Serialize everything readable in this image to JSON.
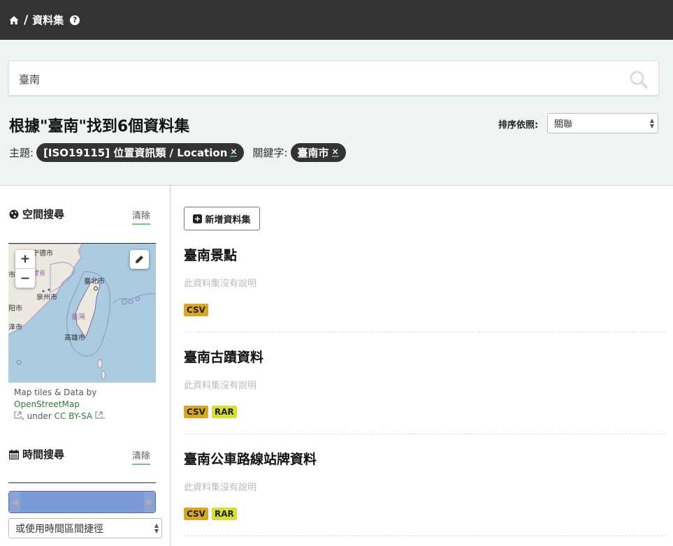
{
  "header": {
    "separator": "/",
    "breadcrumb": "資料集",
    "help_glyph": "?"
  },
  "search": {
    "query": "臺南"
  },
  "results": {
    "heading": "根據\"臺南\"找到6個資料集",
    "sort_label": "排序依照:",
    "sort_value": "關聯"
  },
  "facets": {
    "theme_label": "主題:",
    "theme_value": "[ISO19115] 位置資訊類 / Location",
    "keyword_label": "關鍵字:",
    "keyword_value": "臺南市",
    "remove_glyph": "×"
  },
  "sidebar": {
    "spatial_title": "空間搜尋",
    "clear_label": "清除",
    "map_labels": {
      "ningde": "宁德市",
      "fujian": "福建省",
      "taipei": "臺北市",
      "quanzhou": "泉州市",
      "taiwan": "臺灣",
      "kaohsiung": "高雄市",
      "frag1": "市",
      "frag2": "市",
      "frag3": "阳市",
      "frag4": "泽市"
    },
    "attribution_prefix": "Map tiles & Data by",
    "attribution_osm": "OpenStreetMap",
    "attribution_under": ", under",
    "attribution_license": "CC BY-SA",
    "attribution_end": ".",
    "time_title": "時間搜尋",
    "time_clear_label": "清除",
    "time_select": "或使用時間區間捷徑",
    "zoom_in": "+",
    "zoom_out": "−"
  },
  "actions": {
    "add_dataset": "新增資料集"
  },
  "datasets": [
    {
      "title": "臺南景點",
      "description": "此資料集沒有說明",
      "formats": [
        "CSV"
      ]
    },
    {
      "title": "臺南古蹟資料",
      "description": "此資料集沒有說明",
      "formats": [
        "CSV",
        "RAR"
      ]
    },
    {
      "title": "臺南公車路線站牌資料",
      "description": "此資料集沒有說明",
      "formats": [
        "CSV",
        "RAR"
      ]
    }
  ],
  "colors": {
    "topbar": "#333333",
    "band": "#eef5f1",
    "csv_tag": "#d9a724",
    "rar_tag": "#d8e033",
    "link_green": "#2e7d32"
  }
}
